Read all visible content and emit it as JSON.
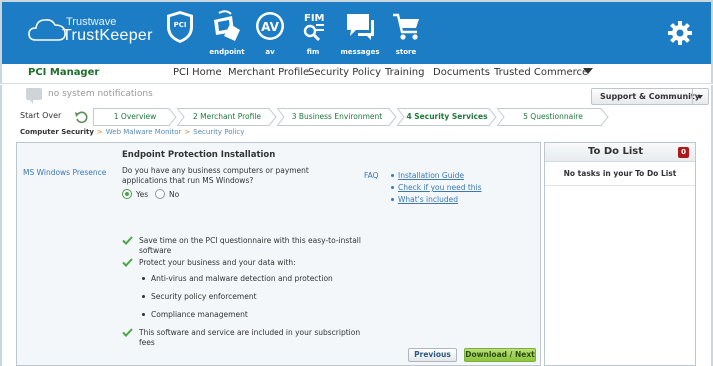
{
  "header": {
    "logo_line1": "Trustwave",
    "logo_line2": "TrustKeeper",
    "logo_mark": "®",
    "nav_icons": [
      {
        "id": "pci",
        "glyph_text": "PCI",
        "caption": "",
        "icon": "pci-shield-icon"
      },
      {
        "id": "endpoint",
        "glyph_text": "",
        "caption": "endpoint",
        "icon": "endpoint-icon"
      },
      {
        "id": "av",
        "glyph_text": "AV",
        "caption": "av",
        "icon": "antivirus-icon"
      },
      {
        "id": "fim",
        "glyph_text": "FIM",
        "caption": "fim",
        "icon": "fim-icon"
      },
      {
        "id": "messages",
        "glyph_text": "",
        "caption": "messages",
        "icon": "messages-icon"
      },
      {
        "id": "store",
        "glyph_text": "",
        "caption": "store",
        "icon": "cart-icon"
      }
    ],
    "settings_icon": "gear-icon",
    "colors": {
      "bar": "#1c7cc4",
      "accent_green": "#1d6f2a"
    }
  },
  "mainnav": {
    "brand": "PCI Manager",
    "tabs": [
      "PCI Home",
      "Merchant Profile",
      "Security Policy",
      "Training",
      "Documents",
      "Trusted Commerce"
    ]
  },
  "notifications": {
    "text": "no system notifications",
    "support_label": "Support & Community"
  },
  "steps": {
    "start_over": "Start Over",
    "items": [
      {
        "label": "1 Overview",
        "active": false
      },
      {
        "label": "2 Merchant Profile",
        "active": false
      },
      {
        "label": "3 Business Environment",
        "active": false
      },
      {
        "label": "4 Security Services",
        "active": true
      },
      {
        "label": "5 Questionnaire",
        "active": false
      }
    ]
  },
  "breadcrumb": [
    "Computer Security",
    "Web Malware Monitor",
    "Security Policy"
  ],
  "panel": {
    "title": "Endpoint Protection Installation",
    "row_label": "MS Windows Presence",
    "question": "Do you have any business computers or payment applications that run MS Windows?",
    "options": [
      {
        "label": "Yes",
        "selected": true
      },
      {
        "label": "No",
        "selected": false
      }
    ],
    "faq_label": "FAQ",
    "faq_links": [
      "Installation Guide",
      "Check if you need this",
      "What's included"
    ],
    "benefits": [
      {
        "type": "check",
        "text": "Save time on the PCI questionnaire with this easy-to-install software"
      },
      {
        "type": "check",
        "text": "Protect your business and your data with:"
      },
      {
        "type": "sub",
        "text": "Anti-virus and malware detection and protection"
      },
      {
        "type": "sub",
        "text": "Security policy enforcement"
      },
      {
        "type": "sub",
        "text": "Compliance management"
      },
      {
        "type": "check",
        "text": "This software and service are included in your subscription fees"
      }
    ],
    "prev_label": "Previous",
    "next_label": "Download / Next"
  },
  "todo": {
    "title": "To Do List",
    "count": "0",
    "empty_text": "No tasks in your To Do List"
  }
}
